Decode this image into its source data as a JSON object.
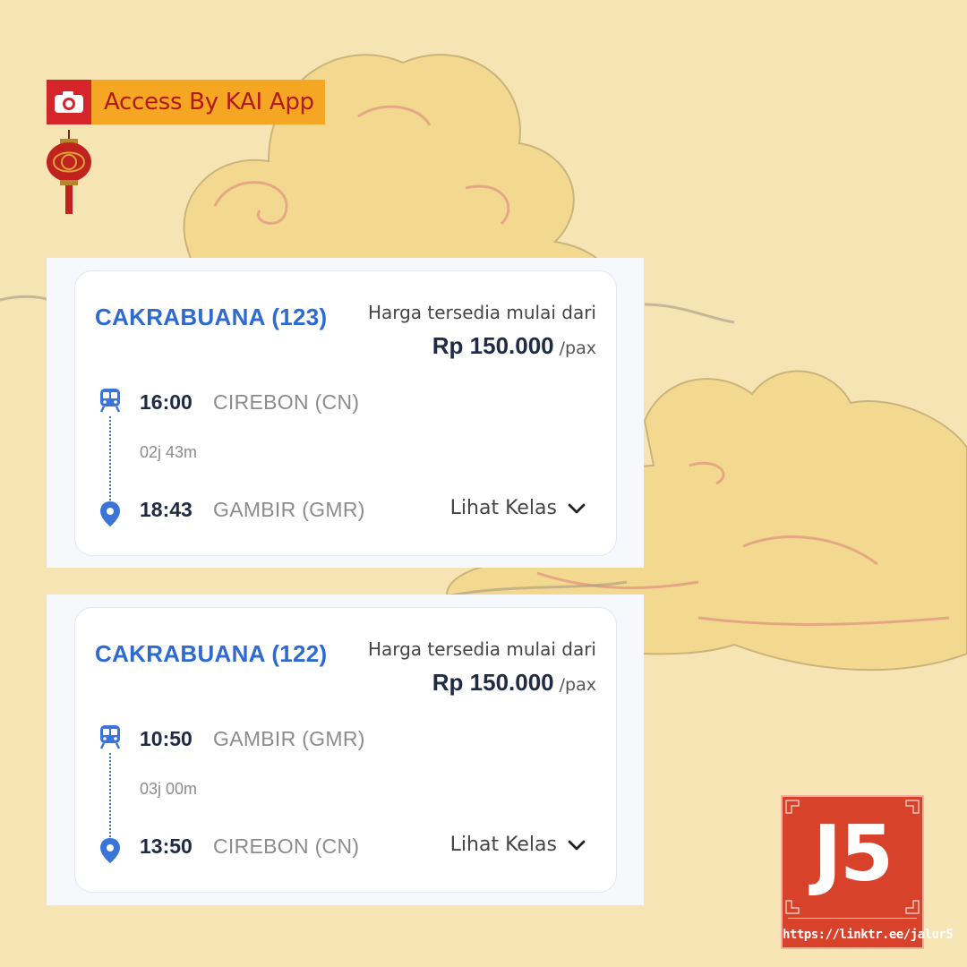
{
  "badge": {
    "label": "Access By KAI App",
    "icon": "camera-icon"
  },
  "decorations": {
    "lantern": "lantern-icon",
    "clouds": "cloud-pattern"
  },
  "trains": [
    {
      "name": "CAKRABUANA (123)",
      "price_note": "Harga tersedia mulai dari",
      "price": "Rp 150.000",
      "per": "/pax",
      "depart_time": "16:00",
      "depart_station": "CIREBON (CN)",
      "duration": "02j 43m",
      "arrive_time": "18:43",
      "arrive_station": "GAMBIR (GMR)",
      "action": "Lihat Kelas"
    },
    {
      "name": "CAKRABUANA (122)",
      "price_note": "Harga tersedia mulai dari",
      "price": "Rp 150.000",
      "per": "/pax",
      "depart_time": "10:50",
      "depart_station": "GAMBIR (GMR)",
      "duration": "03j 00m",
      "arrive_time": "13:50",
      "arrive_station": "CIREBON (CN)",
      "action": "Lihat Kelas"
    }
  ],
  "logo": {
    "text": "J5",
    "url": "https://linktr.ee/jalur5"
  },
  "colors": {
    "background": "#f7e4b4",
    "accent_blue": "#2f6ad1",
    "badge_red": "#d6252a",
    "badge_orange": "#f5a623",
    "logo_red": "#d8422a"
  }
}
